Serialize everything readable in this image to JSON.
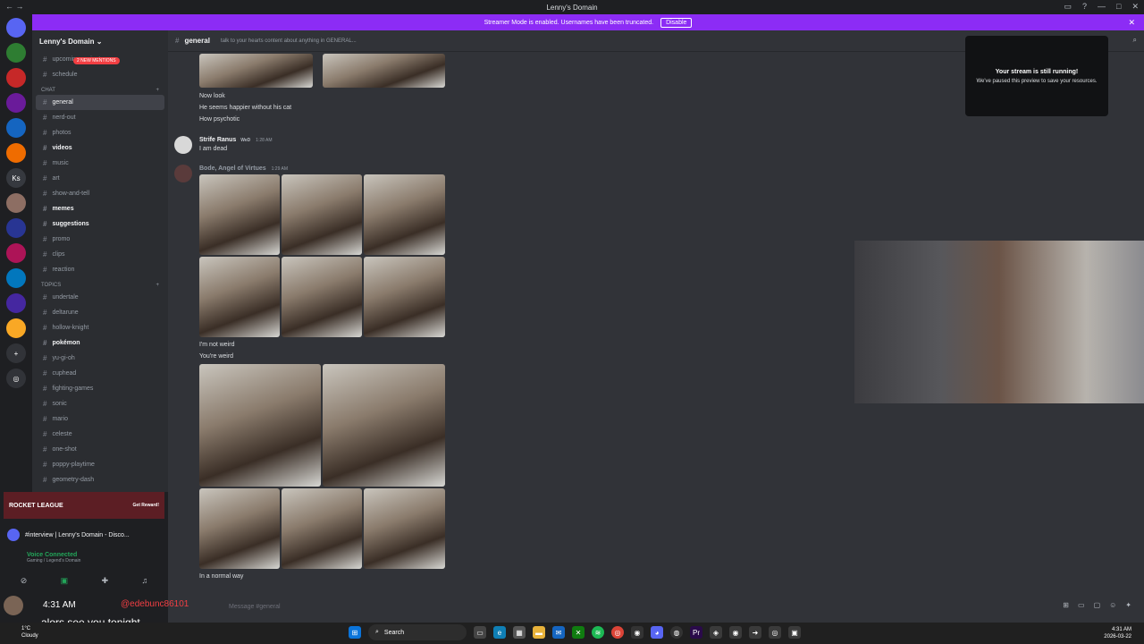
{
  "window": {
    "title": "Lenny's Domain"
  },
  "banner": {
    "text": "Streamer Mode is enabled. Usernames have been truncated.",
    "button": "Disable"
  },
  "servers": [
    {
      "label": "",
      "color": "#5865f2"
    },
    {
      "label": "",
      "color": "#2e7d32"
    },
    {
      "label": "",
      "color": "#c62828"
    },
    {
      "label": "",
      "color": "#6a1b9a"
    },
    {
      "label": "",
      "color": "#1565c0"
    },
    {
      "label": "",
      "color": "#ef6c00"
    },
    {
      "label": "Ks",
      "color": "#36393f"
    },
    {
      "label": "",
      "color": "#8d6e63"
    },
    {
      "label": "",
      "color": "#283593"
    },
    {
      "label": "",
      "color": "#ad1457"
    },
    {
      "label": "",
      "color": "#0277bd"
    },
    {
      "label": "",
      "color": "#4527a0"
    },
    {
      "label": "",
      "color": "#f9a825"
    }
  ],
  "guild": {
    "name": "Lenny's Domain",
    "mentions_badge": "2 NEW MENTIONS",
    "top_channels": [
      "upcoming-projects",
      "schedule"
    ],
    "chat_category": "CHAT",
    "chat_channels": [
      {
        "name": "general",
        "state": "active"
      },
      {
        "name": "nerd-out",
        "state": ""
      },
      {
        "name": "photos",
        "state": ""
      },
      {
        "name": "videos",
        "state": "unread"
      },
      {
        "name": "music",
        "state": ""
      },
      {
        "name": "art",
        "state": ""
      },
      {
        "name": "show-and-tell",
        "state": ""
      },
      {
        "name": "memes",
        "state": "unread"
      },
      {
        "name": "suggestions",
        "state": "unread"
      },
      {
        "name": "promo",
        "state": ""
      },
      {
        "name": "clips",
        "state": ""
      },
      {
        "name": "reaction",
        "state": ""
      }
    ],
    "topics_category": "TOPICS",
    "topic_channels": [
      {
        "name": "undertale",
        "state": ""
      },
      {
        "name": "deltarune",
        "state": ""
      },
      {
        "name": "hollow-knight",
        "state": ""
      },
      {
        "name": "pokémon",
        "state": "unread"
      },
      {
        "name": "yu-gi-oh",
        "state": ""
      },
      {
        "name": "cuphead",
        "state": ""
      },
      {
        "name": "fighting-games",
        "state": ""
      },
      {
        "name": "sonic",
        "state": ""
      },
      {
        "name": "mario",
        "state": ""
      },
      {
        "name": "celeste",
        "state": ""
      },
      {
        "name": "one-shot",
        "state": ""
      },
      {
        "name": "poppy-playtime",
        "state": ""
      },
      {
        "name": "geometry-dash",
        "state": ""
      }
    ]
  },
  "promo": {
    "title": "ROCKET LEAGUE",
    "button": "Get Reward!"
  },
  "stream": {
    "title": "#interview | Lenny's Domain - Disco..."
  },
  "voice": {
    "status": "Voice Connected",
    "location": "Gaming / Legend's Domain"
  },
  "chat": {
    "channel": "general",
    "topic": "talk to your hearts content about anything in GENERAL...",
    "messages": [
      {
        "text": "Now look"
      },
      {
        "text": "He seems happier without his cat"
      },
      {
        "text": "How psychotic"
      }
    ],
    "strife": {
      "author": "Strife Ranus",
      "tag": "WeD",
      "time": "1:28 AM",
      "text": "I am dead"
    },
    "bode": {
      "author": "Bode, Angel of Virtues",
      "time": "1:29 AM"
    },
    "after_grid": [
      "I'm not weird",
      "You're weird"
    ],
    "final": "In a normal way",
    "input_placeholder": "Message #general"
  },
  "popover": {
    "title": "Your stream is still running!",
    "subtitle": "We've paused this preview to save your resources."
  },
  "overlay": {
    "time": "4:31 AM",
    "handle": "@edebunc86101",
    "message": "alors see you tonight"
  },
  "taskbar": {
    "weather_temp": "1°C",
    "weather_cond": "Cloudy",
    "search": "Search",
    "time": "4:31 AM",
    "date": "2026-03-22"
  }
}
